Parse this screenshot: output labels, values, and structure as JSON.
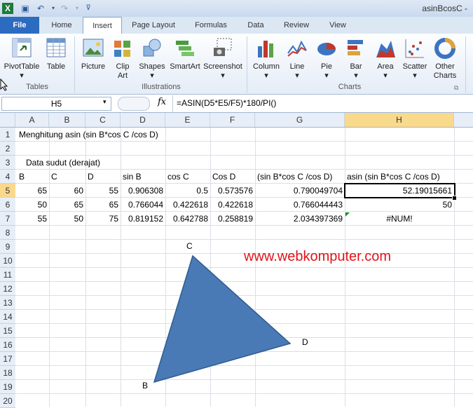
{
  "window": {
    "title": "asinBcosC -"
  },
  "tabs": [
    "File",
    "Home",
    "Insert",
    "Page Layout",
    "Formulas",
    "Data",
    "Review",
    "View"
  ],
  "ribbon": {
    "buttons": [
      "PivotTable",
      "Table",
      "Picture",
      "Clip Art",
      "Shapes",
      "SmartArt",
      "Screenshot",
      "Column",
      "Line",
      "Pie",
      "Bar",
      "Area",
      "Scatter",
      "Other Charts"
    ],
    "groups": [
      "Tables",
      "Illustrations",
      "Charts"
    ]
  },
  "formula_bar": {
    "name_box": "H5",
    "fx": "fx",
    "formula": "=ASIN(D5*E5/F5)*180/PI()"
  },
  "columns": [
    "A",
    "B",
    "C",
    "D",
    "E",
    "F",
    "G",
    "H"
  ],
  "rows": [
    "1",
    "2",
    "3",
    "4",
    "5",
    "6",
    "7",
    "8",
    "9",
    "10",
    "11",
    "12",
    "13",
    "14",
    "15",
    "16",
    "17",
    "18",
    "19",
    "20"
  ],
  "cells": {
    "A1": "Menghitung asin (sin B*cos C /cos D)",
    "A3": "Data sudut (derajat)",
    "A4": "B",
    "B4": "C",
    "C4": "D",
    "D4": "sin B",
    "E4": "cos C",
    "F4": "Cos D",
    "G4": "(sin B*cos C /cos D)",
    "H4": "asin (sin B*cos C /cos D)",
    "A5": "65",
    "B5": "60",
    "C5": "55",
    "D5": "0.906308",
    "E5": "0.5",
    "F5": "0.573576",
    "G5": "0.790049704",
    "H5": "52.19015661",
    "A6": "50",
    "B6": "65",
    "C6": "65",
    "D6": "0.766044",
    "E6": "0.422618",
    "F6": "0.422618",
    "G6": "0.766044443",
    "H6": "50",
    "A7": "55",
    "B7": "50",
    "C7": "75",
    "D7": "0.819152",
    "E7": "0.642788",
    "F7": "0.258819",
    "G7": "2.034397369",
    "H7": "#NUM!"
  },
  "watermark": "www.webkomputer.com",
  "triangle": {
    "label_top": "C",
    "label_right": "D",
    "label_bottom": "B",
    "fill": "#4a7ab5"
  },
  "colors": {
    "file_tab": "#2c6cc0",
    "selected_header": "#f9d98b",
    "watermark": "#e0141a"
  }
}
